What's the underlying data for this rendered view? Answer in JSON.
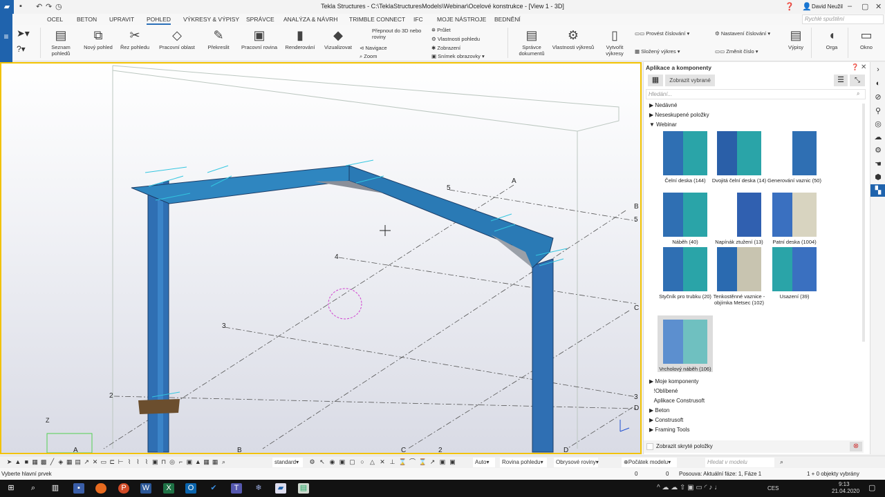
{
  "window": {
    "title": "Tekla Structures - C:\\TeklaStructuresModels\\Webinar\\Ocelové konstrukce - [View 1 - 3D]",
    "user": "David Neužil"
  },
  "tabs": [
    "OCEL",
    "BETON",
    "UPRAVIT",
    "POHLED",
    "VÝKRESY & VÝPISY",
    "SPRÁVCE",
    "ANALÝZA & NÁVRH",
    "TRIMBLE CONNECT",
    "IFC",
    "MOJE NÁSTROJE",
    "BEDNĚNÍ"
  ],
  "active_tab": "POHLED",
  "quick_search_placeholder": "Rychlé spuštění",
  "ribbon": {
    "big": [
      "Seznam pohledů",
      "Nový pohled",
      "Řez pohledu",
      "Pracovní oblast",
      "Překreslit",
      "Pracovní rovina",
      "Renderování",
      "Vizualizovat"
    ],
    "small_a": [
      "Přepnout do 3D nebo roviny",
      "Navigace",
      "Zoom"
    ],
    "small_b": [
      "Průlet",
      "Vlastnosti pohledu",
      "Zobrazení",
      "Snímek obrazovky"
    ],
    "big2": [
      "Správce dokumentů",
      "Vlastnosti výkresů",
      "Vytvořit výkresy"
    ],
    "small_c": [
      "Provést číslování",
      "Složený výkres"
    ],
    "small_d": [
      "Nastavení číslování",
      "Změnit číslo"
    ],
    "big3": [
      "Výpisy",
      "Orga",
      "Okno"
    ]
  },
  "viewport": {
    "grid_labels": {
      "top_A": "A",
      "l5": "5",
      "l4": "4",
      "l3": "3",
      "l2": "2",
      "rB": "B",
      "r5": "5",
      "rC": "C",
      "r3": "3",
      "rD": "D",
      "bA": "A",
      "bB": "B",
      "bC": "C",
      "b2": "2",
      "bD": "D",
      "z": "Z"
    }
  },
  "panel": {
    "title": "Aplikace a komponenty",
    "show_selected": "Zobrazit vybrané",
    "search_placeholder": "Hledání...",
    "tree_top": [
      "Nedávné",
      "Neseskupené položky",
      "Webinar"
    ],
    "components": [
      {
        "name": "Čelní deska (144)"
      },
      {
        "name": "Dvojitá čelní deska (14)"
      },
      {
        "name": "Generování vaznic (50)"
      },
      {
        "name": "Náběh (40)"
      },
      {
        "name": "Napínák ztužení (13)"
      },
      {
        "name": "Patní deska (1004)"
      },
      {
        "name": "Styčník pro trubku (20)"
      },
      {
        "name": "Tenkostěnné vaznice - objímka Metsec (102)"
      },
      {
        "name": "Usazení (39)"
      },
      {
        "name": "Vrcholový náběh (106)"
      }
    ],
    "tree_bottom": [
      {
        "label": "Moje komponenty",
        "arrow": true
      },
      {
        "label": "!Oblíbené",
        "arrow": false
      },
      {
        "label": "Aplikace Construsoft",
        "arrow": false
      },
      {
        "label": "Beton",
        "arrow": true
      },
      {
        "label": "Construsoft",
        "arrow": true
      },
      {
        "label": "Framing Tools",
        "arrow": true
      }
    ],
    "show_hidden": "Zobrazit skryté položky"
  },
  "bottombar": {
    "view_filter": "standard",
    "auto": "Auto",
    "plane": "Rovina pohledu",
    "outline": "Obrysové roviny",
    "origin": "Počátek modelu",
    "search_placeholder": "Hledat v modelu"
  },
  "status": {
    "prompt": "Vyberte hlavní prvek",
    "x": "0",
    "y": "0",
    "phase": "Posouva: Aktuální fáze: 1, Fáze 1",
    "selected": "1 + 0 objekty vybrány"
  },
  "taskbar": {
    "lang": "CES",
    "time": "9:13",
    "date": "21.04.2020"
  },
  "colors": {
    "accent": "#1f63ad",
    "viewport_border": "#f2c200",
    "steel": "#2f7fc0"
  }
}
